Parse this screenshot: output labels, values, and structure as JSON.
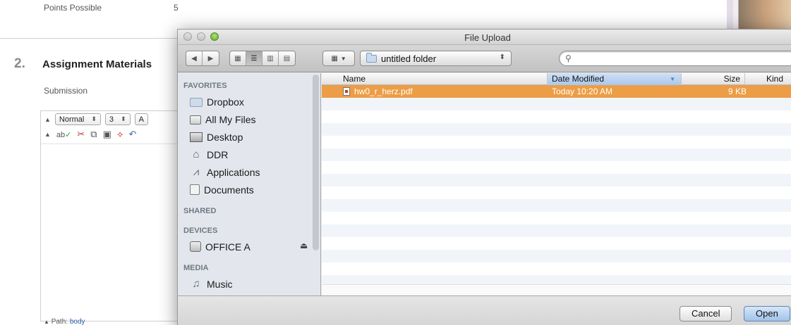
{
  "background": {
    "points_label": "Points Possible",
    "points_value": "5",
    "section_number": "2.",
    "section_title": "Assignment Materials",
    "submission_label": "Submission",
    "editor": {
      "format_select": "Normal",
      "size_select": "3",
      "font_select_partial": "A",
      "path_label": "Path:",
      "path_value": "body"
    }
  },
  "dialog": {
    "title": "File Upload",
    "location": "untitled folder",
    "search": {
      "value": "",
      "placeholder": ""
    },
    "sidebar": {
      "sections": [
        {
          "heading": "FAVORITES",
          "items": [
            {
              "label": "Dropbox",
              "icon": "folder-icon"
            },
            {
              "label": "All My Files",
              "icon": "all-files-icon"
            },
            {
              "label": "Desktop",
              "icon": "desktop-icon"
            },
            {
              "label": "DDR",
              "icon": "home-icon"
            },
            {
              "label": "Applications",
              "icon": "applications-icon"
            },
            {
              "label": "Documents",
              "icon": "documents-icon"
            }
          ]
        },
        {
          "heading": "SHARED",
          "items": []
        },
        {
          "heading": "DEVICES",
          "items": [
            {
              "label": "OFFICE A",
              "icon": "disk-icon",
              "eject": true
            }
          ]
        },
        {
          "heading": "MEDIA",
          "items": [
            {
              "label": "Music",
              "icon": "music-icon"
            }
          ]
        }
      ]
    },
    "columns": {
      "name": "Name",
      "date_modified": "Date Modified",
      "size": "Size",
      "kind": "Kind"
    },
    "files": [
      {
        "name": "hw0_r_herz.pdf",
        "date_modified": "Today 10:20 AM",
        "size": "9 KB",
        "kind": "",
        "selected": true
      }
    ],
    "buttons": {
      "cancel": "Cancel",
      "open": "Open"
    },
    "colors": {
      "selection": "#ec9d45",
      "sidebar": "#e3e7ed",
      "sorted_header": "#a9c7ec"
    }
  }
}
